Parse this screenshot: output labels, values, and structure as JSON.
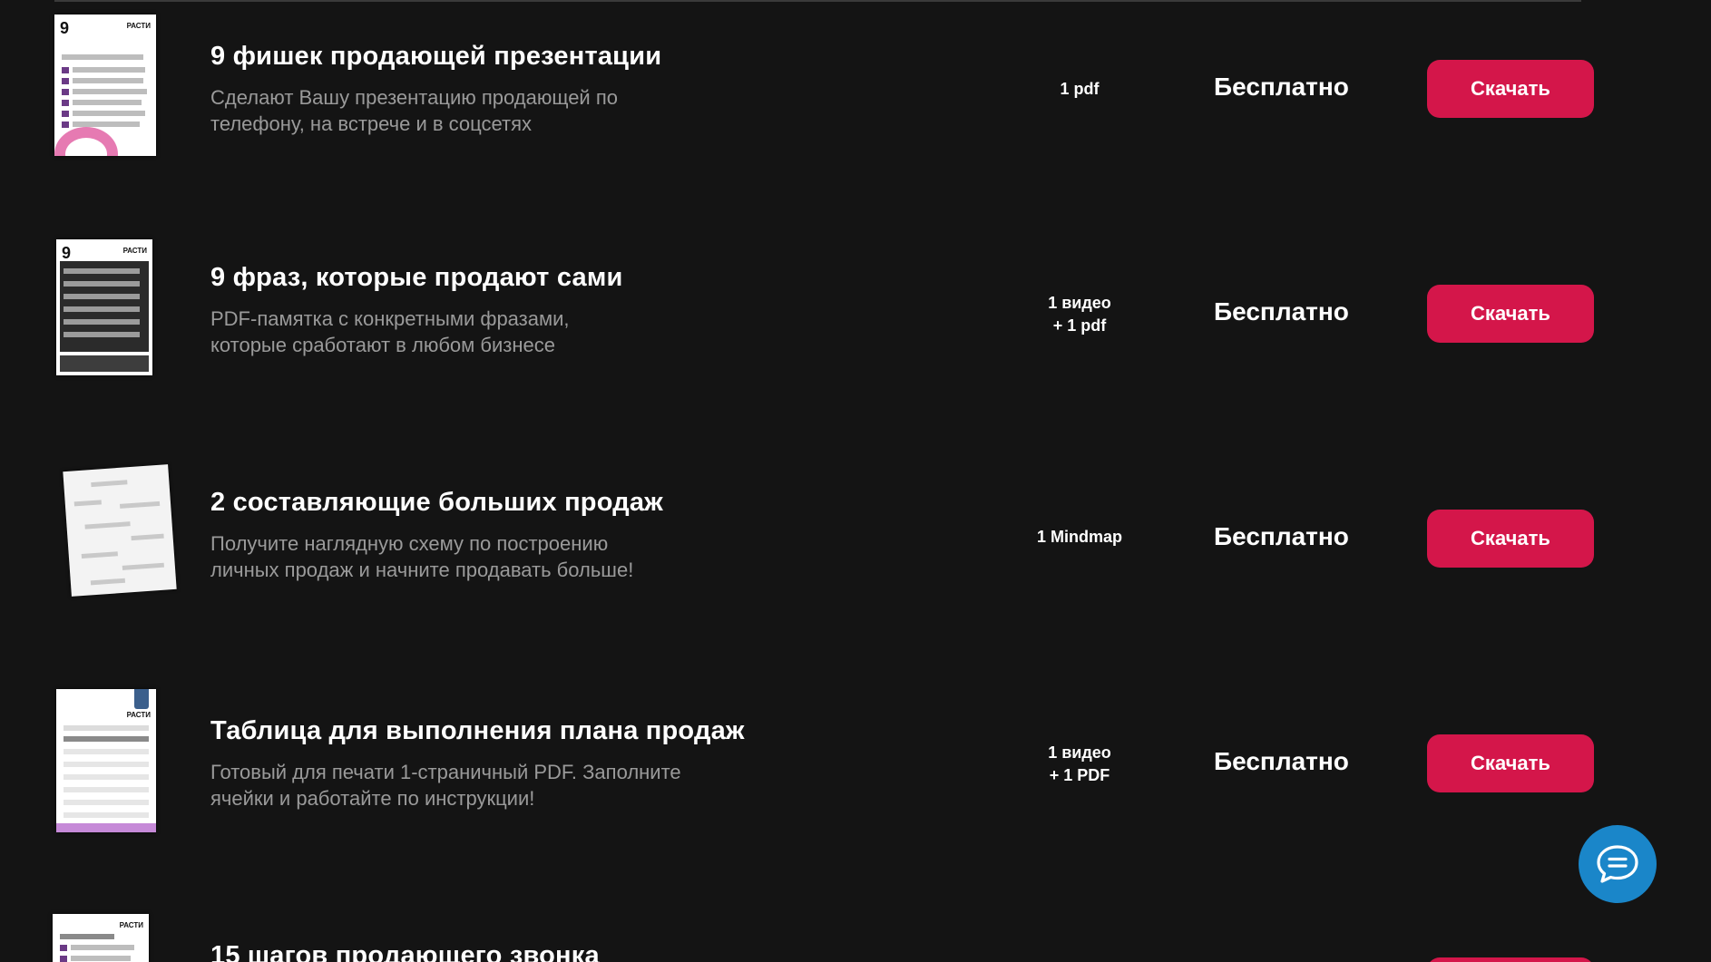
{
  "products": [
    {
      "title": "9 фишек продающей презентации",
      "description_line1": "Сделают Вашу презентацию продающей по",
      "description_line2": "телефону, на встрече и в соцсетях",
      "format_line1": "1 pdf",
      "format_line2": "",
      "price": "Бесплатно",
      "button_label": "Скачать",
      "thumb_heading": "9",
      "thumb_brand": "РАСТИ"
    },
    {
      "title": "9 фраз, которые продают сами",
      "description_line1": "PDF-памятка с конкретными фразами,",
      "description_line2": "которые сработают в любом бизнесе",
      "format_line1": "1 видео",
      "format_line2": "+ 1 pdf",
      "price": "Бесплатно",
      "button_label": "Скачать",
      "thumb_heading": "9",
      "thumb_brand": "РАСТИ"
    },
    {
      "title": "2 составляющие больших продаж",
      "description_line1": "Получите наглядную схему по построению",
      "description_line2": "личных продаж и начните продавать больше!",
      "format_line1": "1 Mindmap",
      "format_line2": "",
      "price": "Бесплатно",
      "button_label": "Скачать",
      "thumb_heading": "",
      "thumb_brand": ""
    },
    {
      "title": "Таблица для выполнения плана продаж",
      "description_line1": "Готовый для печати 1-страничный PDF. Заполните",
      "description_line2": "ячейки и работайте по инструкции!",
      "format_line1": "1 видео",
      "format_line2": "+ 1 PDF",
      "price": "Бесплатно",
      "button_label": "Скачать",
      "thumb_heading": "",
      "thumb_brand": "РАСТИ"
    },
    {
      "title": "15 шагов продающего звонка",
      "thumb_brand": "РАСТИ"
    }
  ],
  "chat": {
    "icon": "chat-bubble-icon"
  },
  "colors": {
    "background": "#141414",
    "accent_button": "#d4164a",
    "chat_button": "#1a86c9",
    "description_text": "#9a9a9a"
  }
}
